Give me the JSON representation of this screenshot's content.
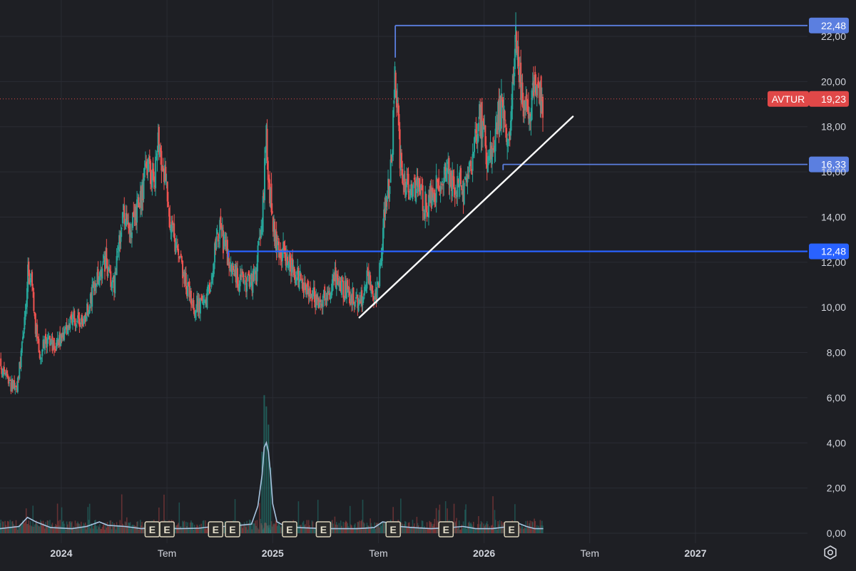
{
  "colors": {
    "background": "#1e1f24",
    "grid": "#2a2c33",
    "text": "#d1d4dc",
    "up": "#26a69a",
    "down": "#ef5350",
    "level_line": "#2962ff",
    "level_label_bg": "#5b7fe0",
    "price_tag": "#e04848",
    "trendline": "#ffffff",
    "volume_ma": "#a7c4e0"
  },
  "chart_data": {
    "type": "candlestick",
    "symbol": "AVTUR",
    "last_price": "19,23",
    "y_ticks": [
      "0,00",
      "2,00",
      "4,00",
      "6,00",
      "8,00",
      "10,00",
      "12,00",
      "14,00",
      "16,00",
      "18,00",
      "20,00",
      "22,00"
    ],
    "y_tick_values": [
      0,
      2,
      4,
      6,
      8,
      10,
      12,
      14,
      16,
      18,
      20,
      22
    ],
    "ylim": [
      -0.6,
      23.6
    ],
    "x_ticks": [
      {
        "label": "2024",
        "t": 2024.0,
        "bold": true
      },
      {
        "label": "Tem",
        "t": 2024.5,
        "bold": false
      },
      {
        "label": "2025",
        "t": 2025.0,
        "bold": true
      },
      {
        "label": "Tem",
        "t": 2025.5,
        "bold": false
      },
      {
        "label": "2026",
        "t": 2026.0,
        "bold": true
      },
      {
        "label": "Tem",
        "t": 2026.5,
        "bold": false
      },
      {
        "label": "2027",
        "t": 2027.0,
        "bold": true
      }
    ],
    "xlim": [
      2023.71,
      2027.53
    ],
    "grid": true,
    "price_series": {
      "t": [
        2023.7,
        2023.75,
        2023.79,
        2023.82,
        2023.84,
        2023.86,
        2023.88,
        2023.9,
        2023.93,
        2023.97,
        2024.02,
        2024.06,
        2024.1,
        2024.14,
        2024.17,
        2024.21,
        2024.25,
        2024.28,
        2024.3,
        2024.33,
        2024.37,
        2024.4,
        2024.42,
        2024.44,
        2024.46,
        2024.49,
        2024.51,
        2024.54,
        2024.58,
        2024.62,
        2024.65,
        2024.68,
        2024.72,
        2024.75,
        2024.77,
        2024.8,
        2024.82,
        2024.85,
        2024.88,
        2024.92,
        2024.95,
        2024.97,
        2024.98,
        2025.0,
        2025.02,
        2025.04,
        2025.07,
        2025.1,
        2025.14,
        2025.18,
        2025.21,
        2025.24,
        2025.27,
        2025.3,
        2025.33,
        2025.37,
        2025.4,
        2025.43,
        2025.45,
        2025.47,
        2025.49,
        2025.5,
        2025.52,
        2025.54,
        2025.56,
        2025.58,
        2025.6,
        2025.61,
        2025.63,
        2025.65,
        2025.68,
        2025.72,
        2025.76,
        2025.8,
        2025.83,
        2025.86,
        2025.9,
        2025.94,
        2025.98,
        2026.02,
        2026.05,
        2026.07,
        2026.09,
        2026.11,
        2026.13,
        2026.15,
        2026.16,
        2026.17,
        2026.19,
        2026.21,
        2026.23,
        2026.25,
        2026.28
      ],
      "close": [
        7.8,
        6.6,
        6.5,
        8.5,
        11.5,
        11.0,
        9.0,
        8.0,
        8.5,
        8.3,
        8.8,
        9.5,
        9.2,
        10.5,
        11.2,
        12.0,
        10.8,
        13.5,
        14.2,
        13.5,
        14.5,
        15.8,
        16.2,
        15.5,
        17.5,
        16.0,
        14.0,
        12.5,
        11.5,
        10.0,
        10.2,
        9.9,
        12.0,
        13.5,
        12.8,
        11.8,
        11.5,
        11.2,
        11.0,
        11.3,
        14.0,
        17.5,
        16.0,
        13.5,
        12.8,
        12.4,
        12.3,
        11.5,
        11.0,
        10.8,
        10.3,
        10.5,
        10.6,
        11.3,
        10.9,
        10.5,
        10.3,
        10.4,
        11.5,
        10.8,
        10.6,
        11.0,
        13.5,
        15.0,
        16.0,
        20.5,
        17.0,
        16.0,
        15.5,
        15.0,
        15.3,
        14.5,
        15.0,
        15.5,
        16.0,
        15.6,
        15.3,
        16.5,
        18.5,
        16.5,
        17.5,
        18.5,
        19.0,
        17.0,
        18.5,
        22.0,
        21.0,
        20.0,
        19.0,
        18.0,
        20.0,
        19.5,
        19.23
      ],
      "pos_t": [
        2023.6,
        2023.7,
        2023.75,
        2023.79,
        2023.82,
        2023.84,
        2023.86,
        2023.88,
        2023.9,
        2023.93,
        2023.97,
        2024.02,
        2024.06,
        2024.1,
        2024.14,
        2024.17,
        2024.21,
        2024.25,
        2024.28,
        2024.3,
        2024.33,
        2024.37,
        2024.4,
        2024.42,
        2024.44,
        2024.46,
        2024.49,
        2024.51,
        2024.54,
        2024.58,
        2024.62,
        2024.65,
        2024.68,
        2024.72,
        2024.75,
        2024.77,
        2024.8,
        2024.82,
        2024.85,
        2024.88,
        2024.92,
        2024.95,
        2024.97,
        2024.98,
        2025.0,
        2025.02,
        2025.04,
        2025.07,
        2025.1,
        2025.14,
        2025.18,
        2025.21,
        2025.24,
        2025.27,
        2025.3,
        2025.33,
        2025.37,
        2025.4,
        2025.43,
        2025.45,
        2025.47,
        2025.49,
        2025.5,
        2025.52,
        2025.54,
        2025.56,
        2025.58,
        2025.6,
        2025.61,
        2025.63,
        2025.65,
        2025.68,
        2025.72,
        2025.76,
        2025.8,
        2025.83,
        2025.86,
        2025.9,
        2025.94,
        2025.98,
        2026.02,
        2026.05,
        2026.07,
        2026.09,
        2026.11,
        2026.13,
        2026.15,
        2026.16,
        2026.17,
        2026.19,
        2026.21,
        2026.23,
        2026.25,
        2026.28
      ]
    },
    "volume_ma": {
      "t": [
        2023.71,
        2023.8,
        2023.84,
        2023.88,
        2023.95,
        2024.05,
        2024.12,
        2024.18,
        2024.22,
        2024.3,
        2024.38,
        2024.45,
        2024.55,
        2024.65,
        2024.72,
        2024.78,
        2024.84,
        2024.9,
        2024.93,
        2024.95,
        2024.96,
        2024.97,
        2024.98,
        2024.99,
        2025.0,
        2025.02,
        2025.06,
        2025.12,
        2025.25,
        2025.4,
        2025.48,
        2025.52,
        2025.56,
        2025.6,
        2025.66,
        2025.75,
        2025.84,
        2025.9,
        2025.96,
        2026.04,
        2026.12,
        2026.16,
        2026.2,
        2026.24,
        2026.28
      ],
      "values": [
        0.2,
        0.3,
        0.7,
        0.5,
        0.25,
        0.2,
        0.3,
        0.5,
        0.35,
        0.3,
        0.2,
        0.25,
        0.2,
        0.22,
        0.3,
        0.3,
        0.35,
        0.4,
        1.2,
        2.6,
        3.8,
        4.0,
        3.6,
        2.6,
        1.3,
        0.5,
        0.3,
        0.25,
        0.2,
        0.2,
        0.25,
        0.5,
        0.45,
        0.3,
        0.25,
        0.2,
        0.25,
        0.3,
        0.2,
        0.2,
        0.3,
        0.45,
        0.3,
        0.2,
        0.2
      ]
    },
    "volume_spikes": [
      {
        "t": 2024.96,
        "v": 6.1
      },
      {
        "t": 2024.97,
        "v": 5.6
      },
      {
        "t": 2024.98,
        "v": 4.8
      },
      {
        "t": 2024.95,
        "v": 3.6
      },
      {
        "t": 2024.99,
        "v": 2.9
      }
    ],
    "levels": [
      {
        "label": "22,48",
        "value": 22.48,
        "t_start": 2025.58
      },
      {
        "label": "16,33",
        "value": 16.33,
        "t_start": 2026.09
      },
      {
        "label": "12,48",
        "value": 12.48,
        "t_start": 2024.79
      }
    ],
    "trendline": {
      "t1": 2025.41,
      "v1": 9.55,
      "t2": 2026.42,
      "v2": 18.45
    },
    "earnings_markers": [
      {
        "label": "E",
        "t": 2024.43
      },
      {
        "label": "E",
        "t": 2024.5
      },
      {
        "label": "E",
        "t": 2024.73
      },
      {
        "label": "E",
        "t": 2024.81
      },
      {
        "label": "E",
        "t": 2025.08
      },
      {
        "label": "E",
        "t": 2025.24
      },
      {
        "label": "E",
        "t": 2025.57
      },
      {
        "label": "E",
        "t": 2025.82
      },
      {
        "label": "E",
        "t": 2026.13
      }
    ]
  },
  "ui": {
    "settings_icon": "gear-icon"
  }
}
